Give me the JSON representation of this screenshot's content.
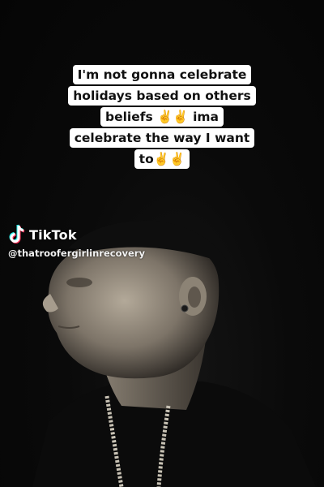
{
  "caption": {
    "lines": [
      "I'm not gonna celebrate",
      "holidays based on others",
      "beliefs ✌️✌️ ima",
      "celebrate the way I want",
      "to✌️✌️"
    ]
  },
  "watermark": {
    "brand": "TikTok",
    "handle": "@thatroofergirlinrecovery",
    "logo_icon": "tiktok-note-icon"
  },
  "colors": {
    "background": "#060606",
    "caption_bg": "#ffffff",
    "caption_text": "#111111",
    "logo_cyan": "#25f4ee",
    "logo_red": "#fe2c55"
  }
}
